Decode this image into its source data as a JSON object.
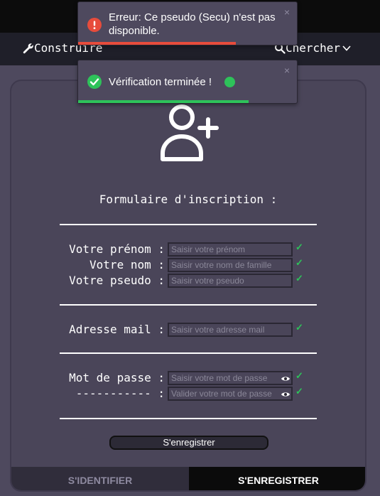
{
  "nav": {
    "build_label": "Construire",
    "search_label": "Chercher"
  },
  "form": {
    "title": "Formulaire d'inscription :",
    "fields": {
      "firstname": {
        "label": "Votre prénom :",
        "placeholder": "Saisir votre prénom"
      },
      "lastname": {
        "label": "Votre nom :",
        "placeholder": "Saisir votre nom de famille"
      },
      "pseudo": {
        "label": "Votre pseudo :",
        "placeholder": "Saisir votre pseudo"
      },
      "email": {
        "label": "Adresse mail :",
        "placeholder": "Saisir votre adresse mail"
      },
      "password": {
        "label": "Mot de passe :",
        "placeholder": "Saisir votre mot de passe"
      },
      "password_confirm": {
        "label": "----------- :",
        "placeholder": "Valider votre mot de passe"
      }
    },
    "submit_label": "S'enregistrer",
    "check_glyph": "✓"
  },
  "tabs": {
    "login": "S'IDENTIFIER",
    "register": "S'ENREGISTRER"
  },
  "toasts": {
    "error": {
      "text": "Erreur: Ce pseudo (Secu) n'est pas disponible.",
      "close": "×",
      "color": "#e74c3c",
      "progress": 0.72
    },
    "success": {
      "text": "Vérification terminée !",
      "close": "×",
      "color": "#2ec25a",
      "progress": 0.78
    }
  }
}
